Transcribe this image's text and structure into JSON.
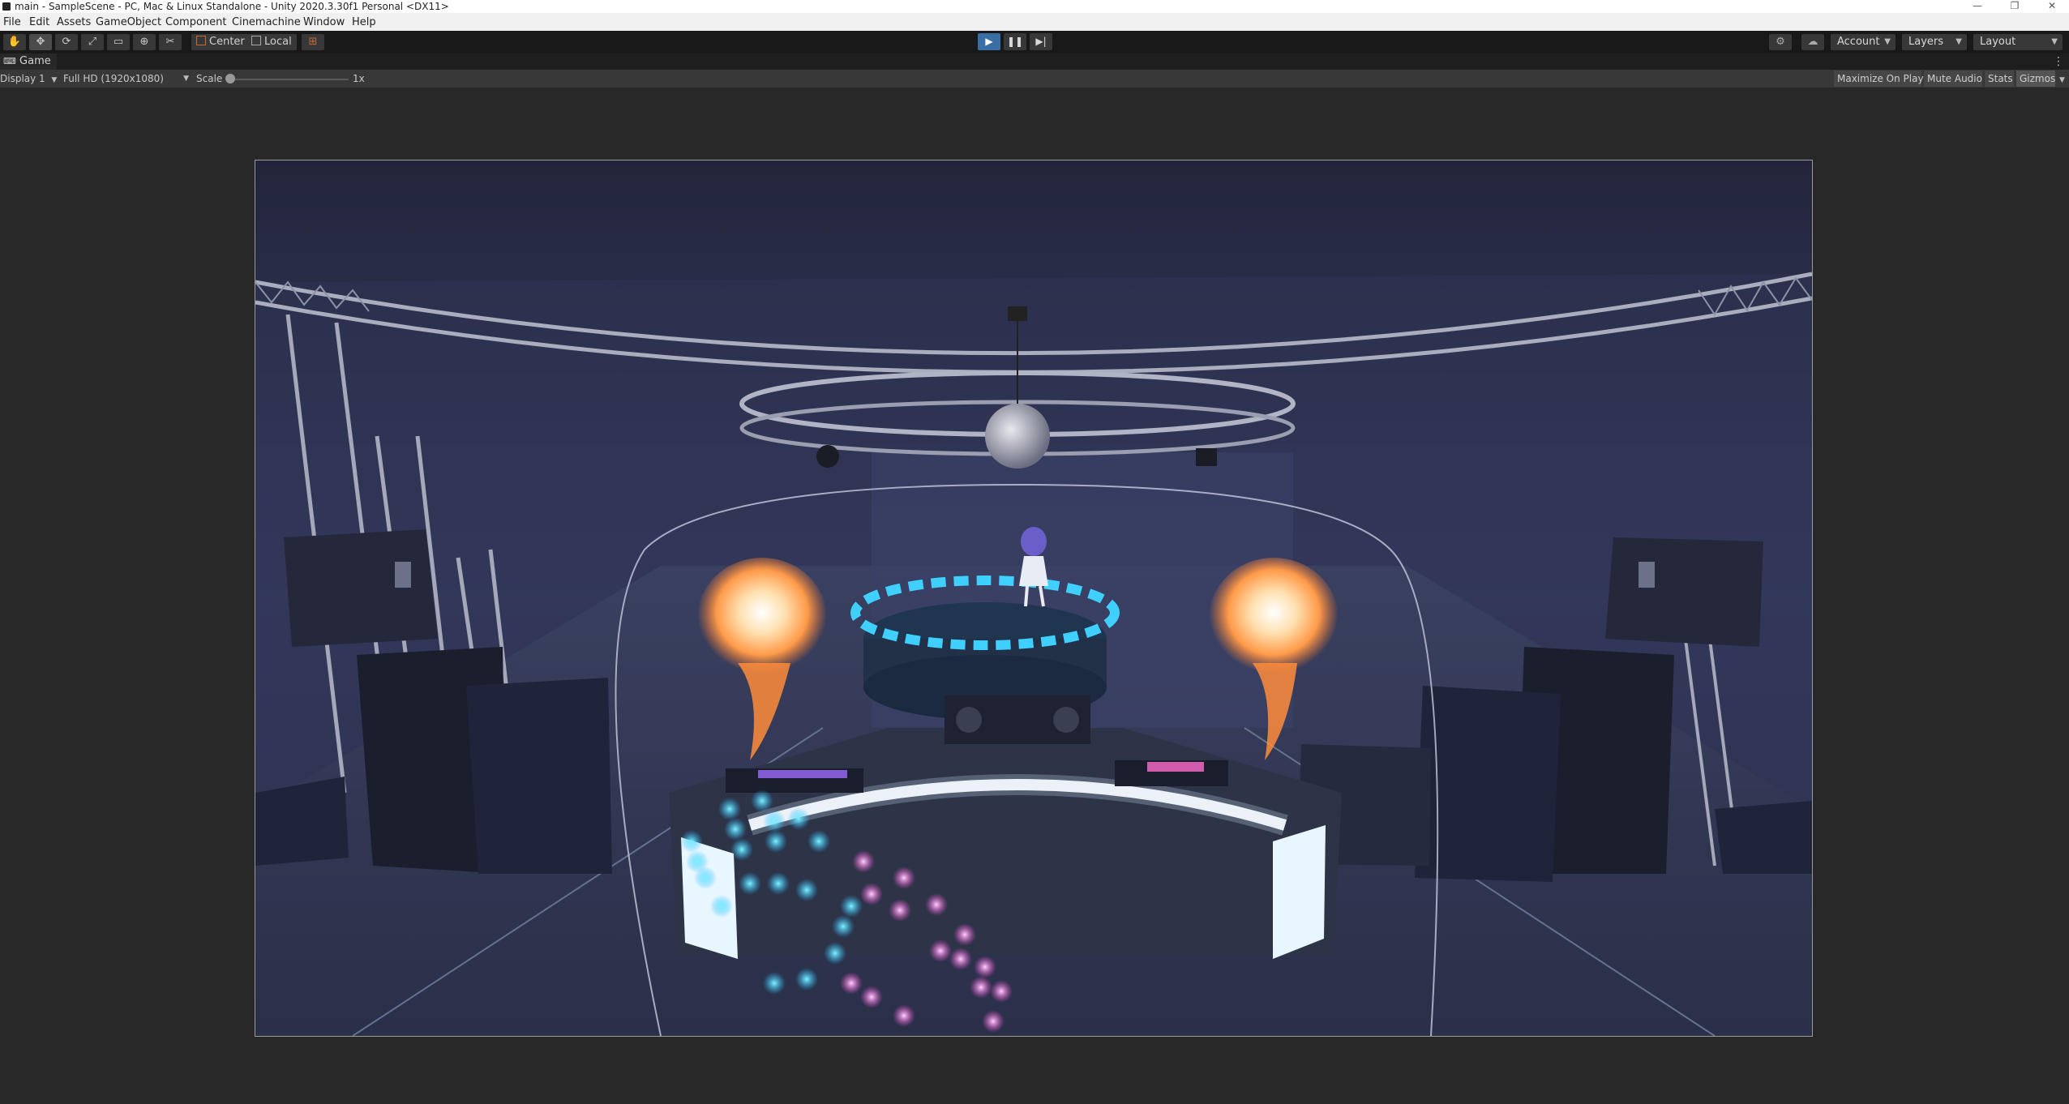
{
  "window": {
    "title": "main - SampleScene - PC, Mac & Linux Standalone - Unity 2020.3.30f1 Personal <DX11>",
    "controls": [
      "—",
      "❐",
      "✕"
    ]
  },
  "menu": [
    "File",
    "Edit",
    "Assets",
    "GameObject",
    "Component",
    "Cinemachine",
    "Window",
    "Help"
  ],
  "toolbar": {
    "tools": [
      "hand-tool-icon",
      "move-tool-icon",
      "rotate-tool-icon",
      "scale-tool-icon",
      "rect-tool-icon",
      "transform-tool-icon",
      "custom-tool-icon"
    ],
    "active_tool": "move-tool-icon",
    "pivot_mode": "Center",
    "pivot_space": "Local",
    "play_state": "playing",
    "account_label": "Account",
    "layers_label": "Layers",
    "layout_label": "Layout",
    "accent_color": "#3a6ea5"
  },
  "game_view": {
    "tab_label": "Game",
    "display": "Display 1",
    "resolution": "Full HD (1920x1080)",
    "scale_label": "Scale",
    "scale_value": "1x",
    "buttons": {
      "maximize": "Maximize On Play",
      "mute": "Mute Audio",
      "stats": "Stats",
      "gizmos": "Gizmos"
    }
  }
}
